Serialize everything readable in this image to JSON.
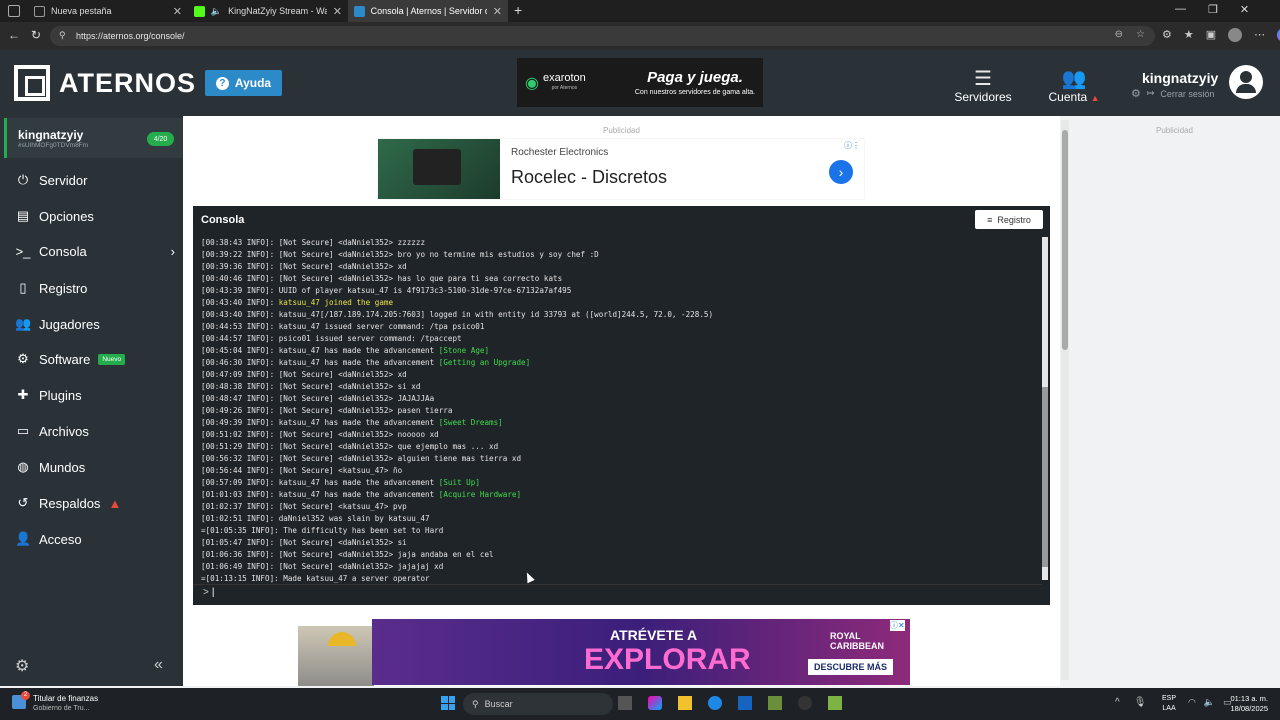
{
  "browser": {
    "tabs": [
      {
        "title": "Nueva pestaña"
      },
      {
        "title": "KingNatZyiy Stream - Watch"
      },
      {
        "title": "Consola | Aternos | Servidor de M"
      }
    ],
    "url": "https://aternos.org/console/"
  },
  "header": {
    "logo": "ATERNOS",
    "help": "Ayuda",
    "ad": {
      "brand": "exaroton",
      "sub": "por Aternos",
      "headline": "Paga y juega.",
      "tagline": "Con nuestros servidores de gama alta."
    },
    "servers": "Servidores",
    "account": "Cuenta",
    "username": "kingnatzyiy",
    "logout": "Cerrar sesión"
  },
  "sidebar": {
    "server_name": "kingnatzyiy",
    "server_id": "#sUIhMOFg0TDVm8Fm",
    "players_badge": "4/20",
    "items": [
      {
        "label": "Servidor",
        "icon": "power-icon"
      },
      {
        "label": "Opciones",
        "icon": "options-icon"
      },
      {
        "label": "Consola",
        "icon": "terminal-icon"
      },
      {
        "label": "Registro",
        "icon": "file-icon"
      },
      {
        "label": "Jugadores",
        "icon": "users-icon"
      },
      {
        "label": "Software",
        "icon": "cube-icon",
        "badge": "Nuevo"
      },
      {
        "label": "Plugins",
        "icon": "puzzle-icon"
      },
      {
        "label": "Archivos",
        "icon": "folder-icon"
      },
      {
        "label": "Mundos",
        "icon": "globe-icon"
      },
      {
        "label": "Respaldos",
        "icon": "archive-icon"
      },
      {
        "label": "Acceso",
        "icon": "user-icon"
      }
    ]
  },
  "ads": {
    "label": "Publicidad",
    "mid": {
      "company": "Rochester Electronics",
      "headline": "Rocelec - Discretos"
    },
    "bottom": {
      "line1": "ATRÉVETE A",
      "line2": "EXPLORAR",
      "brand1": "ROYAL",
      "brand2": "CARIBBEAN",
      "cta": "DESCUBRE MÁS"
    }
  },
  "console": {
    "title": "Consola",
    "log_button": "Registro",
    "prompt": ">",
    "lines": [
      {
        "text": "[00:38:43 INFO]: [Not Secure] <daNniel352> zzzzzz"
      },
      {
        "text": "[00:39:22 INFO]: [Not Secure] <daNniel352> bro yo no termine mis estudios y soy chef :D"
      },
      {
        "text": "[00:39:36 INFO]: [Not Secure] <daNniel352> xd"
      },
      {
        "text": "[00:40:46 INFO]: [Not Secure] <daNniel352> has lo que para ti sea correcto kats"
      },
      {
        "text": "[00:43:39 INFO]: UUID of player katsuu_47 is 4f9173c3-5100-31de-97ce-67132a7af495"
      },
      {
        "text": "[00:43:40 INFO]: ",
        "hl": "katsuu_47 joined the game"
      },
      {
        "text": "[00:43:40 INFO]: katsuu_47[/187.189.174.205:7603] logged in with entity id 33793 at ([world]244.5, 72.0, -228.5)"
      },
      {
        "text": "[00:44:53 INFO]: katsuu_47 issued server command: /tpa psico01"
      },
      {
        "text": "[00:44:57 INFO]: psico01 issued server command: /tpaccept"
      },
      {
        "text": "[00:45:04 INFO]: katsuu_47 has made the advancement ",
        "adv": "[Stone Age]"
      },
      {
        "text": "[00:46:30 INFO]: katsuu_47 has made the advancement ",
        "adv": "[Getting an Upgrade]"
      },
      {
        "text": "[00:47:09 INFO]: [Not Secure] <daNniel352> xd"
      },
      {
        "text": "[00:48:38 INFO]: [Not Secure] <daNniel352> si xd"
      },
      {
        "text": "[00:48:47 INFO]: [Not Secure] <daNniel352> JAJAJJAa"
      },
      {
        "text": "[00:49:26 INFO]: [Not Secure] <daNniel352> pasen tierra"
      },
      {
        "text": "[00:49:39 INFO]: katsuu_47 has made the advancement ",
        "adv": "[Sweet Dreams]"
      },
      {
        "text": "[00:51:02 INFO]: [Not Secure] <daNniel352> nooooo xd"
      },
      {
        "text": "[00:51:29 INFO]: [Not Secure] <daNniel352> que ejemplo mas ... xd"
      },
      {
        "text": "[00:56:32 INFO]: [Not Secure] <daNniel352> alguien tiene mas tierra xd"
      },
      {
        "text": "[00:56:44 INFO]: [Not Secure] <katsuu_47> ño"
      },
      {
        "text": "[00:57:09 INFO]: katsuu_47 has made the advancement ",
        "adv": "[Suit Up]"
      },
      {
        "text": "[01:01:03 INFO]: katsuu_47 has made the advancement ",
        "adv": "[Acquire Hardware]"
      },
      {
        "text": "[01:02:37 INFO]: [Not Secure] <katsuu_47> pvp"
      },
      {
        "text": "[01:02:51 INFO]: daNniel352 was slain by katsuu_47"
      },
      {
        "text": "=[01:05:35 INFO]: The difficulty has been set to Hard"
      },
      {
        "text": "[01:05:47 INFO]: [Not Secure] <daNniel352> si"
      },
      {
        "text": "[01:06:36 INFO]: [Not Secure] <daNniel352> jaja andaba en el cel"
      },
      {
        "text": "[01:06:49 INFO]: [Not Secure] <daNniel352> jajajaj xd"
      },
      {
        "text": "=[01:13:15 INFO]: Made katsuu_47 a server operator"
      }
    ]
  },
  "taskbar": {
    "news_title": "Titular de finanzas",
    "news_sub": "Gobierno de Tru...",
    "news_badge": "2",
    "search": "Buscar",
    "lang": "ESP",
    "lang2": "LAA",
    "time": "01:13 a. m.",
    "date": "18/08/2025"
  },
  "colors": {
    "accent": "#2d8ac9",
    "green": "#25ad4d",
    "header": "#2a3237"
  }
}
